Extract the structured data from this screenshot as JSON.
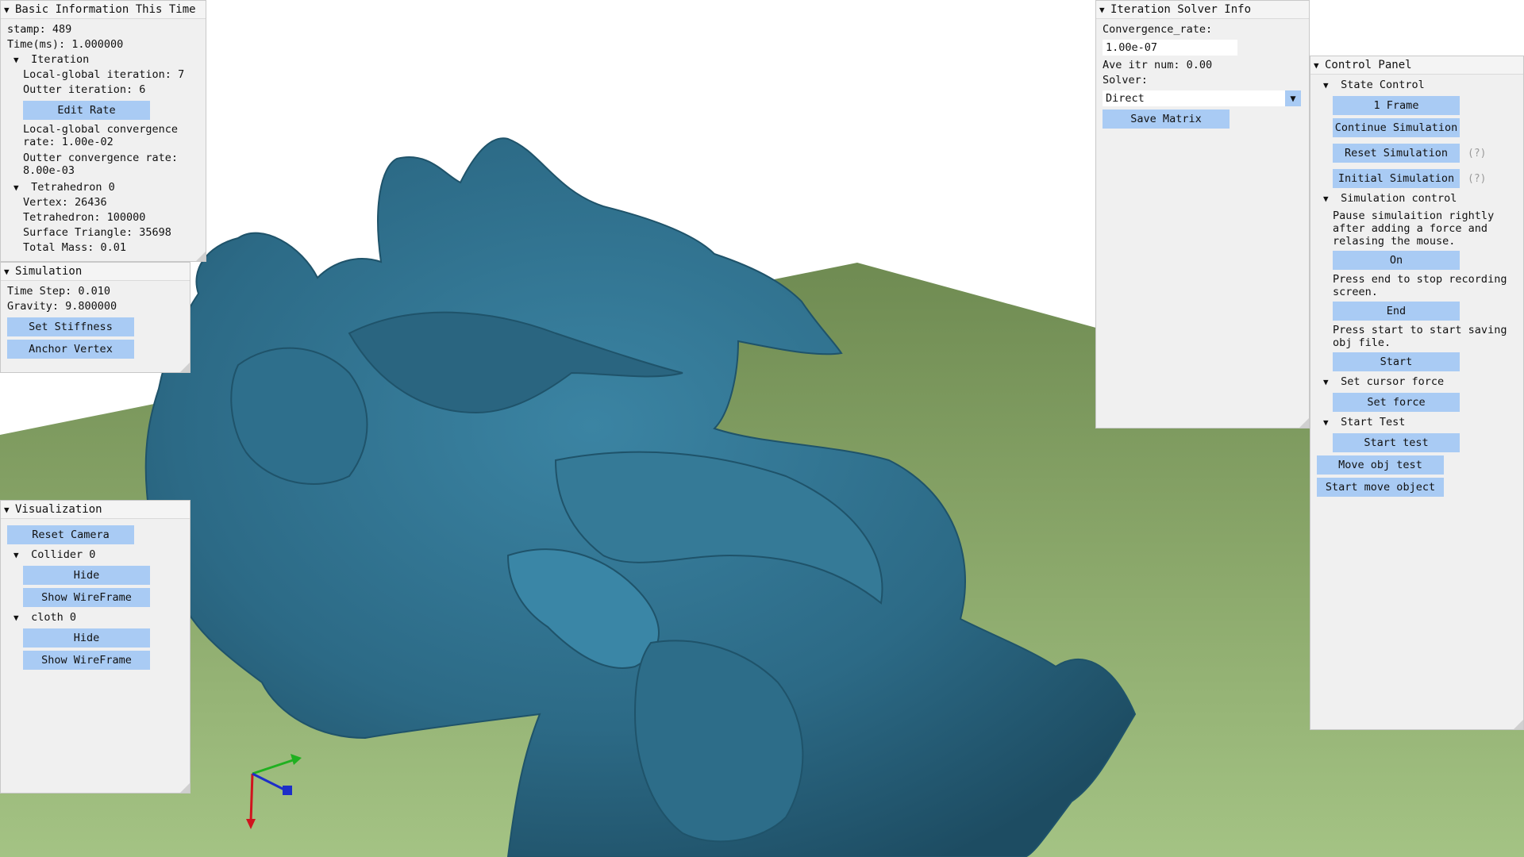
{
  "basic_info": {
    "title": "Basic Information This Time",
    "stamp": "stamp: 489",
    "time": "Time(ms): 1.000000",
    "iteration_header": "Iteration",
    "local_global_iter": "Local-global iteration: 7",
    "outer_iter": "Outter iteration: 6",
    "edit_rate": "Edit Rate",
    "lg_conv": "Local-global convergence rate: 1.00e-02",
    "outer_conv": "Outter convergence rate: 8.00e-03",
    "tetra_header": "Tetrahedron 0",
    "vertex": "Vertex: 26436",
    "tetrahedron": "Tetrahedron: 100000",
    "surface_tri": "Surface Triangle: 35698",
    "total_mass": "Total Mass: 0.01"
  },
  "simulation": {
    "title": "Simulation",
    "time_step": "Time Step: 0.010",
    "gravity": "Gravity: 9.800000",
    "set_stiffness": "Set Stiffness",
    "anchor_vertex": "Anchor Vertex"
  },
  "visualization": {
    "title": "Visualization",
    "reset_camera": "Reset Camera",
    "collider_header": "Collider 0",
    "collider_hide": "Hide",
    "collider_wire": "Show WireFrame",
    "cloth_header": "cloth 0",
    "cloth_hide": "Hide",
    "cloth_wire": "Show WireFrame"
  },
  "solver_info": {
    "title": "Iteration Solver Info",
    "conv_label": "Convergence_rate:",
    "conv_value": "1.00e-07",
    "ave_itr": "Ave itr num: 0.00",
    "solver_label": "Solver:",
    "solver_value": "Direct",
    "save_matrix": "Save Matrix"
  },
  "control_panel": {
    "title": "Control Panel",
    "state_header": "State Control",
    "one_frame": "1 Frame",
    "continue": "Continue Simulation",
    "reset": "Reset Simulation",
    "initial": "Initial Simulation",
    "help": "(?)",
    "sim_control_header": "Simulation control",
    "pause_text": "Pause simulaition rightly after adding a force and relasing the mouse.",
    "on": "On",
    "end_text": "Press end to stop recording screen.",
    "end": "End",
    "start_text": "Press start to start saving obj file.",
    "start": "Start",
    "cursor_header": "Set cursor force",
    "set_force": "Set force",
    "test_header": "Start Test",
    "start_test": "Start test",
    "move_obj_test": "Move obj test",
    "start_move": "Start move object"
  },
  "colors": {
    "mesh": "#2f6c86",
    "ground": "#7c9a5e",
    "button": "#a9cbf4",
    "panel": "#f0f0f0"
  }
}
